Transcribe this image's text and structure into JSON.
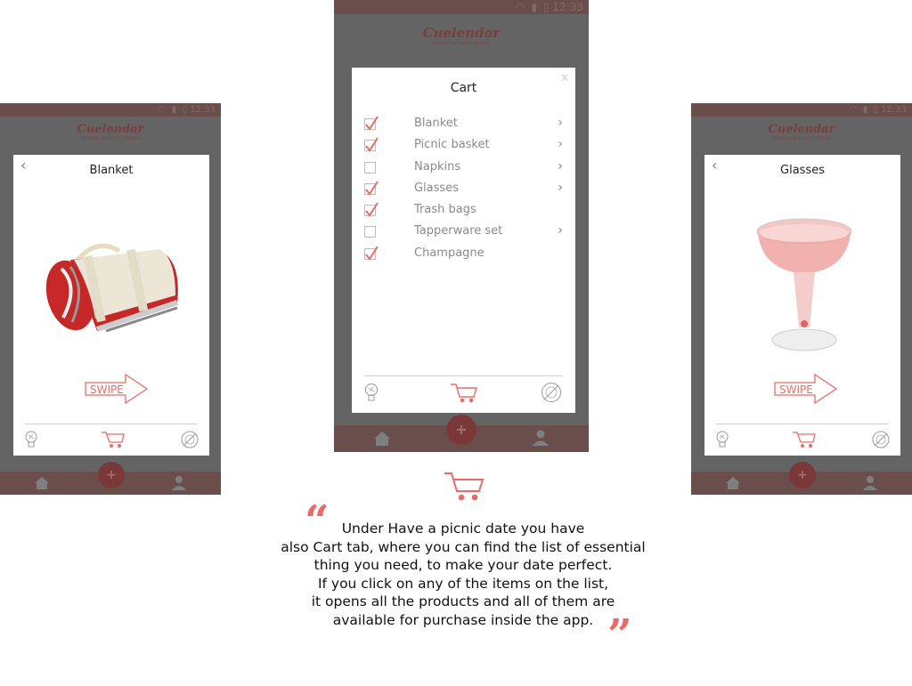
{
  "app": {
    "logo": "Cuelendar",
    "tagline": "IMPRESS WITHOUT STRESS",
    "status_time": "12:33"
  },
  "colors": {
    "accent": "#ea6b66",
    "navbar": "#6a4e4c",
    "overlay": "#646464",
    "plus_button": "#7a3838"
  },
  "icons": {
    "wifi": "wifi-icon",
    "signal": "signal-icon",
    "battery": "battery-icon",
    "back": "chevron-left-icon",
    "chevron": "chevron-right-icon",
    "close": "close-icon",
    "idea": "lightbulb-icon",
    "cart": "cart-icon",
    "compass": "compass-icon",
    "home": "home-icon",
    "plus": "plus-icon",
    "user": "user-icon"
  },
  "screens": {
    "left": {
      "title": "Blanket",
      "product_image": "rolled picnic blanket",
      "swipe_label": "SWIPE"
    },
    "center": {
      "title": "Cart",
      "close_label": "×",
      "items": [
        {
          "label": "Blanket",
          "checked": true,
          "has_chevron": true
        },
        {
          "label": "Picnic basket",
          "checked": true,
          "has_chevron": true
        },
        {
          "label": "Napkins",
          "checked": false,
          "has_chevron": true
        },
        {
          "label": "Glasses",
          "checked": true,
          "has_chevron": true
        },
        {
          "label": "Trash bags",
          "checked": true,
          "has_chevron": false
        },
        {
          "label": "Tapperware set",
          "checked": false,
          "has_chevron": true
        },
        {
          "label": "Champagne",
          "checked": true,
          "has_chevron": false
        }
      ]
    },
    "right": {
      "title": "Glasses",
      "product_image": "pink champagne glass",
      "swipe_label": "SWIPE"
    }
  },
  "description": {
    "open_quote": "“",
    "close_quote": "”",
    "lines": [
      "Under Have a picnic date you have",
      "also Cart tab, where you can find the list of essential",
      "thing you need, to make your date perfect.",
      "If you click on any of the items on the list,",
      "it opens all the products and all of them are",
      "available for purchase inside the app."
    ]
  },
  "symbols": {
    "back": "‹",
    "chevron": "›",
    "plus": "+"
  }
}
